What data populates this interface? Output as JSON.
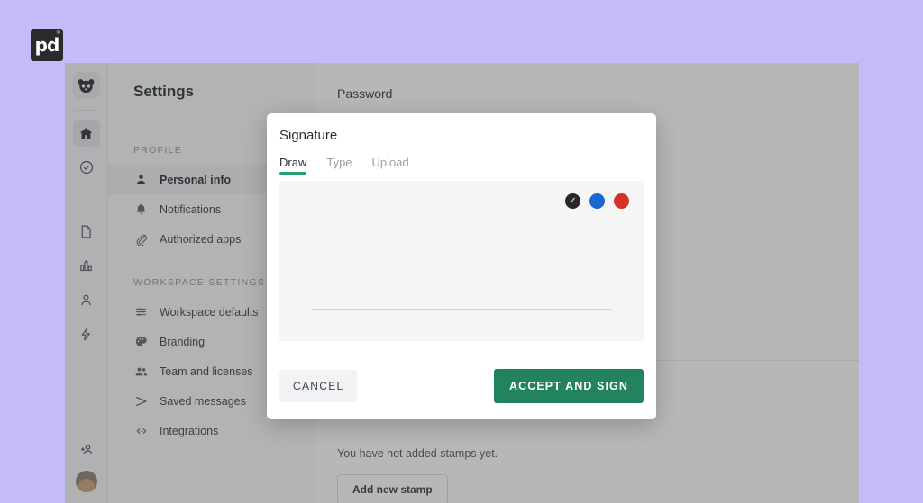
{
  "brand": {
    "logo_text": "pd",
    "registered_mark": "®",
    "logo_bg": "#2b2b2b"
  },
  "icon_rail": {
    "items": [
      {
        "name": "panda-logo-icon",
        "label": "Panda"
      },
      {
        "name": "home-icon",
        "label": "Home",
        "active": true
      },
      {
        "name": "check-circle-icon",
        "label": "Approvals"
      },
      {
        "name": "document-icon",
        "label": "Documents"
      },
      {
        "name": "chart-icon",
        "label": "Reports"
      },
      {
        "name": "person-icon",
        "label": "Contacts"
      },
      {
        "name": "lightning-icon",
        "label": "Automations"
      },
      {
        "name": "add-user-icon",
        "label": "Invite"
      },
      {
        "name": "avatar",
        "label": "Account"
      }
    ]
  },
  "settings_sidebar": {
    "title": "Settings",
    "sections": [
      {
        "label": "PROFILE",
        "items": [
          {
            "label": "Personal info",
            "icon": "person-icon",
            "active": true
          },
          {
            "label": "Notifications",
            "icon": "bell-icon",
            "active": false
          },
          {
            "label": "Authorized apps",
            "icon": "paperclip-icon",
            "active": false
          }
        ]
      },
      {
        "label": "WORKSPACE SETTINGS",
        "items": [
          {
            "label": "Workspace defaults",
            "icon": "sliders-icon",
            "active": false
          },
          {
            "label": "Branding",
            "icon": "palette-icon",
            "active": false
          },
          {
            "label": "Team and licenses",
            "icon": "people-icon",
            "active": false
          },
          {
            "label": "Saved messages",
            "icon": "send-icon",
            "active": false
          },
          {
            "label": "Integrations",
            "icon": "code-icon",
            "active": false
          }
        ]
      }
    ]
  },
  "main": {
    "title": "Password",
    "stamps": {
      "empty_text": "You have not added stamps yet.",
      "add_button_label": "Add new stamp"
    }
  },
  "modal": {
    "title": "Signature",
    "tabs": [
      {
        "label": "Draw",
        "active": true
      },
      {
        "label": "Type",
        "active": false
      },
      {
        "label": "Upload",
        "active": false
      }
    ],
    "colors": [
      {
        "name": "black",
        "hex": "#282828",
        "selected": true,
        "check": "✓"
      },
      {
        "name": "blue",
        "hex": "#1867d2",
        "selected": false
      },
      {
        "name": "red",
        "hex": "#d93025",
        "selected": false
      }
    ],
    "cancel_label": "CANCEL",
    "accept_label": "ACCEPT AND SIGN",
    "accent_color": "#22835c"
  },
  "page": {
    "background_color": "#c4bcf9"
  }
}
